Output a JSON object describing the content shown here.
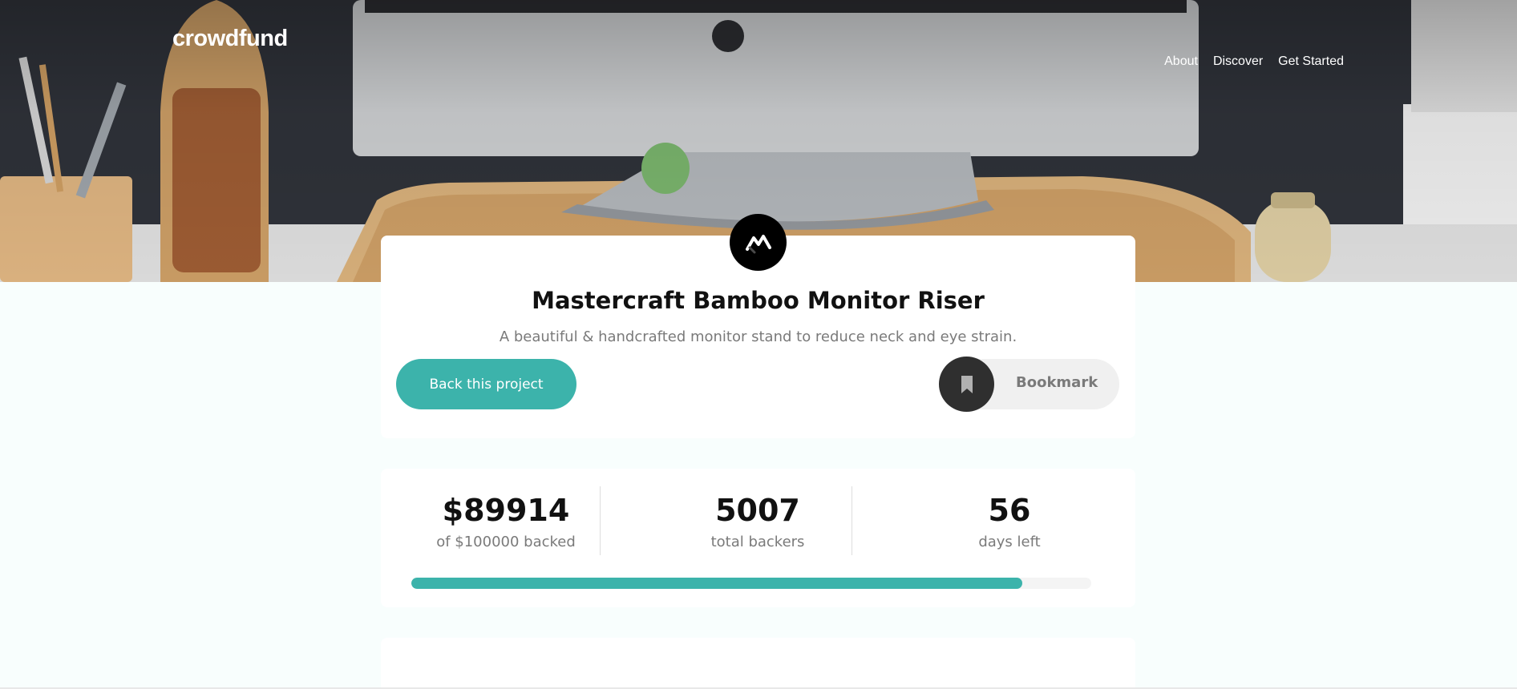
{
  "header": {
    "logo": "crowdfund",
    "nav": [
      "About",
      "Discover",
      "Get Started"
    ]
  },
  "project": {
    "title": "Mastercraft Bamboo Monitor Riser",
    "description": "A beautiful & handcrafted monitor stand to reduce neck and eye strain.",
    "back_label": "Back this project",
    "bookmark_label": "Bookmark"
  },
  "stats": {
    "backed_amount": "$89914",
    "backed_label": "of $100000 backed",
    "backers": "5007",
    "backers_label": "total backers",
    "days": "56",
    "days_label": "days left",
    "progress_fraction": 0.89914
  },
  "colors": {
    "accent": "#3cb3ab",
    "dark": "#2f2f2f",
    "page_background": "#f8fefd"
  },
  "icons": {
    "project_logo": "mastercraft-logo-icon",
    "bookmark": "bookmark-icon"
  }
}
